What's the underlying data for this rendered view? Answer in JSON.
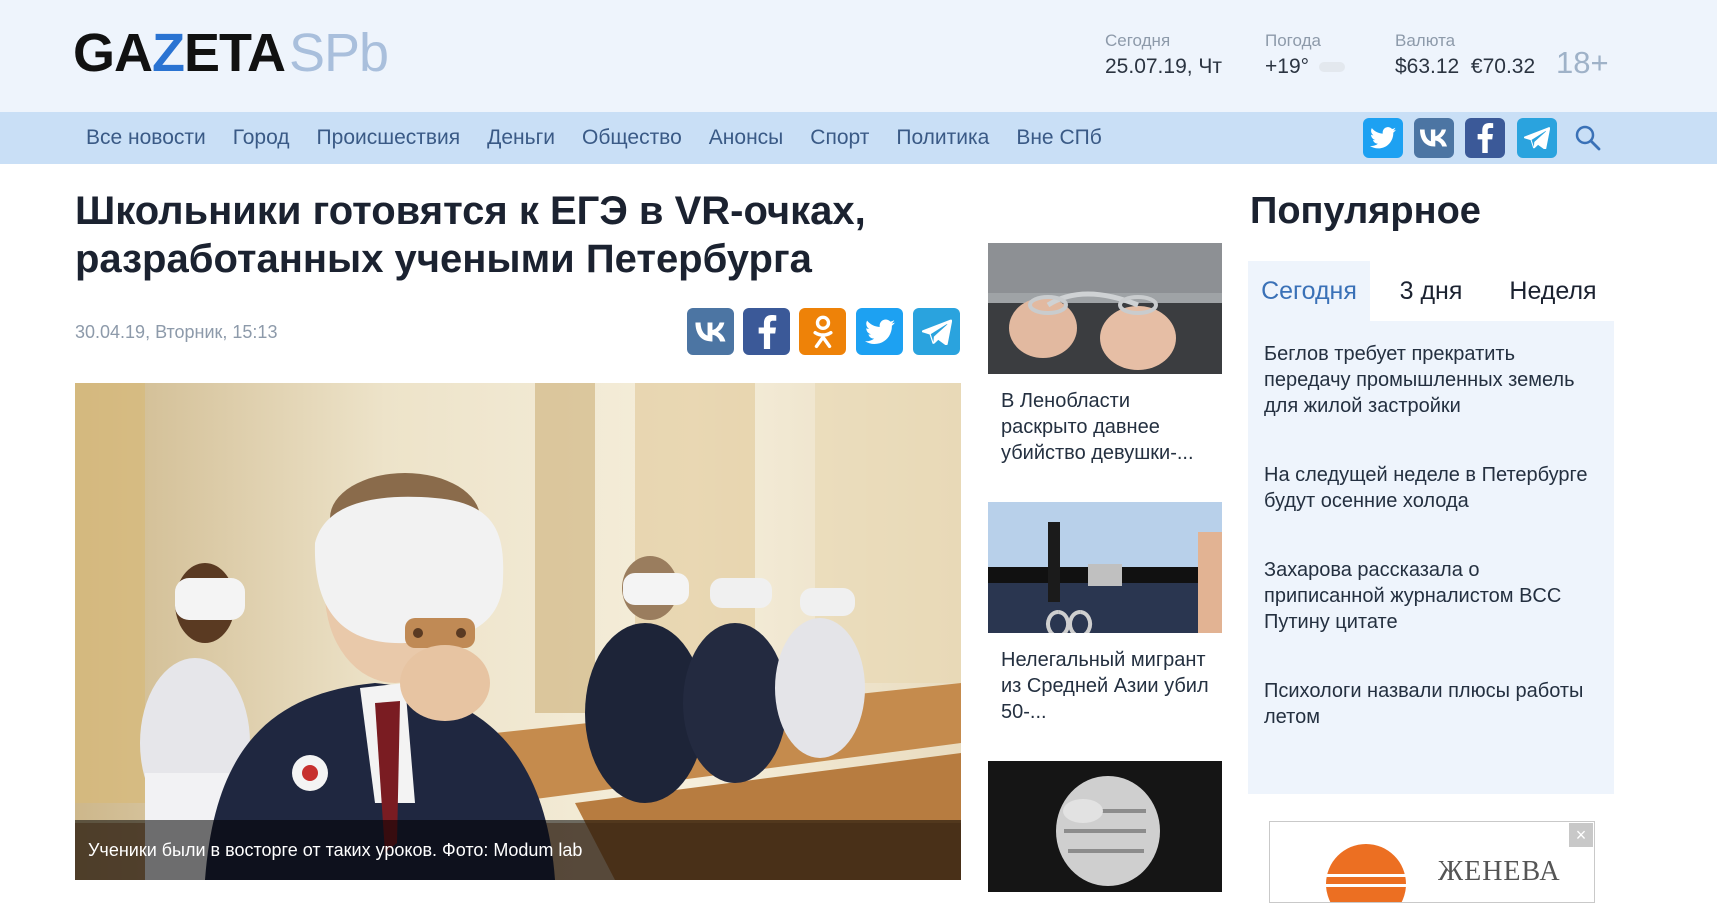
{
  "logo": {
    "part1": "GA",
    "part2": "Z",
    "part3": "ETA",
    "part4": "SPb"
  },
  "header": {
    "today_label": "Сегодня",
    "today_value": "25.07.19, Чт",
    "weather_label": "Погода",
    "weather_value": "+19°",
    "currency_label": "Валюта",
    "currency_usd": "$63.12",
    "currency_eur": "€70.32",
    "age": "18+"
  },
  "nav": {
    "items": [
      "Все новости",
      "Город",
      "Происшествия",
      "Деньги",
      "Общество",
      "Анонсы",
      "Спорт",
      "Политика",
      "Вне СПб"
    ]
  },
  "social_icons": [
    "twitter-icon",
    "vk-icon",
    "facebook-icon",
    "telegram-icon",
    "search-icon"
  ],
  "colors": {
    "twitter": "#1da1f2",
    "vk": "#4c75a3",
    "facebook": "#3b5998",
    "ok": "#ee8208",
    "telegram": "#2aa3de",
    "nav_bg": "#c9dff6",
    "accent": "#3a71b7"
  },
  "article": {
    "title": "Школьники готовятся к ЕГЭ в VR-очках, разработанных учеными Петербурга",
    "date": "30.04.19, Вторник, 15:13",
    "caption": "Ученики были в восторге от таких уроков. Фото: Modum lab"
  },
  "side_news": [
    {
      "text": "В Ленобласти раскрыто давнее убийство девушки-..."
    },
    {
      "text": "Нелегальный мигрант из Средней Азии убил 50-..."
    }
  ],
  "popular": {
    "title": "Популярное",
    "tabs": [
      "Сегодня",
      "3 дня",
      "Неделя"
    ],
    "items": [
      "Беглов требует прекратить передачу промышленных земель для жилой застройки",
      "На следущей неделе в Петербурге будут осенние холода",
      "Захарова рассказала о приписанной журналистом BCC Путину цитате",
      "Психологи назвали плюсы работы летом"
    ]
  },
  "ad": {
    "name": "ЖЕНЕВА",
    "close": "×"
  }
}
